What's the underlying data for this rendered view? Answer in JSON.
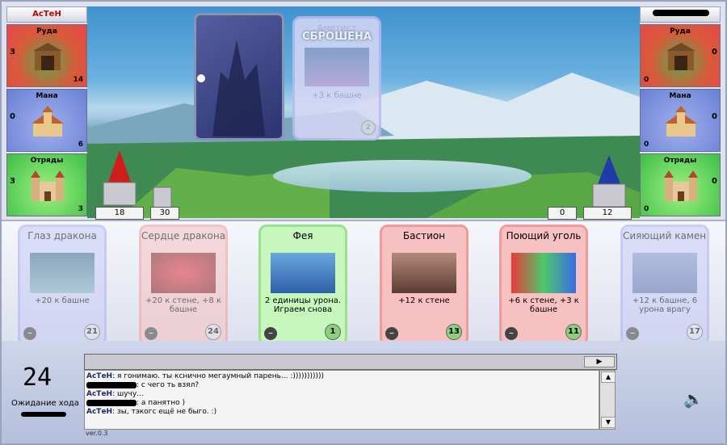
{
  "player": {
    "name": "АсТеН"
  },
  "resources_left": [
    {
      "label": "Руда",
      "prod": "3",
      "amount": "14",
      "kind": "ore"
    },
    {
      "label": "Мана",
      "prod": "0",
      "amount": "6",
      "kind": "mana"
    },
    {
      "label": "Отряды",
      "prod": "3",
      "amount": "3",
      "kind": "troops"
    }
  ],
  "resources_right": [
    {
      "label": "Руда",
      "prod": "0",
      "amount": "0",
      "kind": "ore"
    },
    {
      "label": "Мана",
      "prod": "0",
      "amount": "0",
      "kind": "mana"
    },
    {
      "label": "Отряды",
      "prod": "0",
      "amount": "0",
      "kind": "troops"
    }
  ],
  "towers": {
    "left_tower": "18",
    "left_wall": "30",
    "right_wall": "0",
    "right_tower": "12"
  },
  "played_card": {
    "title": "Аметист",
    "stamp": "СБРОШЕНА",
    "desc": "+3 к башне",
    "cost": "2"
  },
  "hand": [
    {
      "title": "Глаз дракона",
      "desc": "+20 к башне",
      "cost": "21",
      "style": "blue",
      "dim": true
    },
    {
      "title": "Сердце дракона",
      "desc": "+20 к стене, +8 к башне",
      "cost": "24",
      "style": "red",
      "dim": true
    },
    {
      "title": "Фея",
      "desc": "2 единицы урона. Играем снова",
      "cost": "1",
      "style": "green",
      "dim": false
    },
    {
      "title": "Бастион",
      "desc": "+12 к стене",
      "cost": "13",
      "style": "red",
      "dim": false
    },
    {
      "title": "Поющий уголь",
      "desc": "+6 к стене, +3 к башне",
      "cost": "11",
      "style": "red",
      "dim": false
    },
    {
      "title": "Сияющий камень",
      "desc": "+12 к башне, 6 урона врагу",
      "cost": "17",
      "style": "blue",
      "dim": true
    }
  ],
  "status": {
    "timer": "24",
    "waiting": "Ожидание хода"
  },
  "chat": [
    {
      "who": "АсТеН",
      "text": ": я гонимаю. ты кснично мегаумный парень... :)))))))))))"
    },
    {
      "who": "",
      "text": ": с чего ть взял?"
    },
    {
      "who": "АсТеН",
      "text": ": шучу..."
    },
    {
      "who": "",
      "text": ": а панятно )"
    },
    {
      "who": "АсТеН",
      "text": ": зы, тэкогс ещё не быго. :)"
    }
  ],
  "version": "ver.0.3",
  "colors": {
    "blue_card": "#c7ccf7",
    "red_card": "#f7c1c1",
    "green_card": "#c7f7bd"
  }
}
